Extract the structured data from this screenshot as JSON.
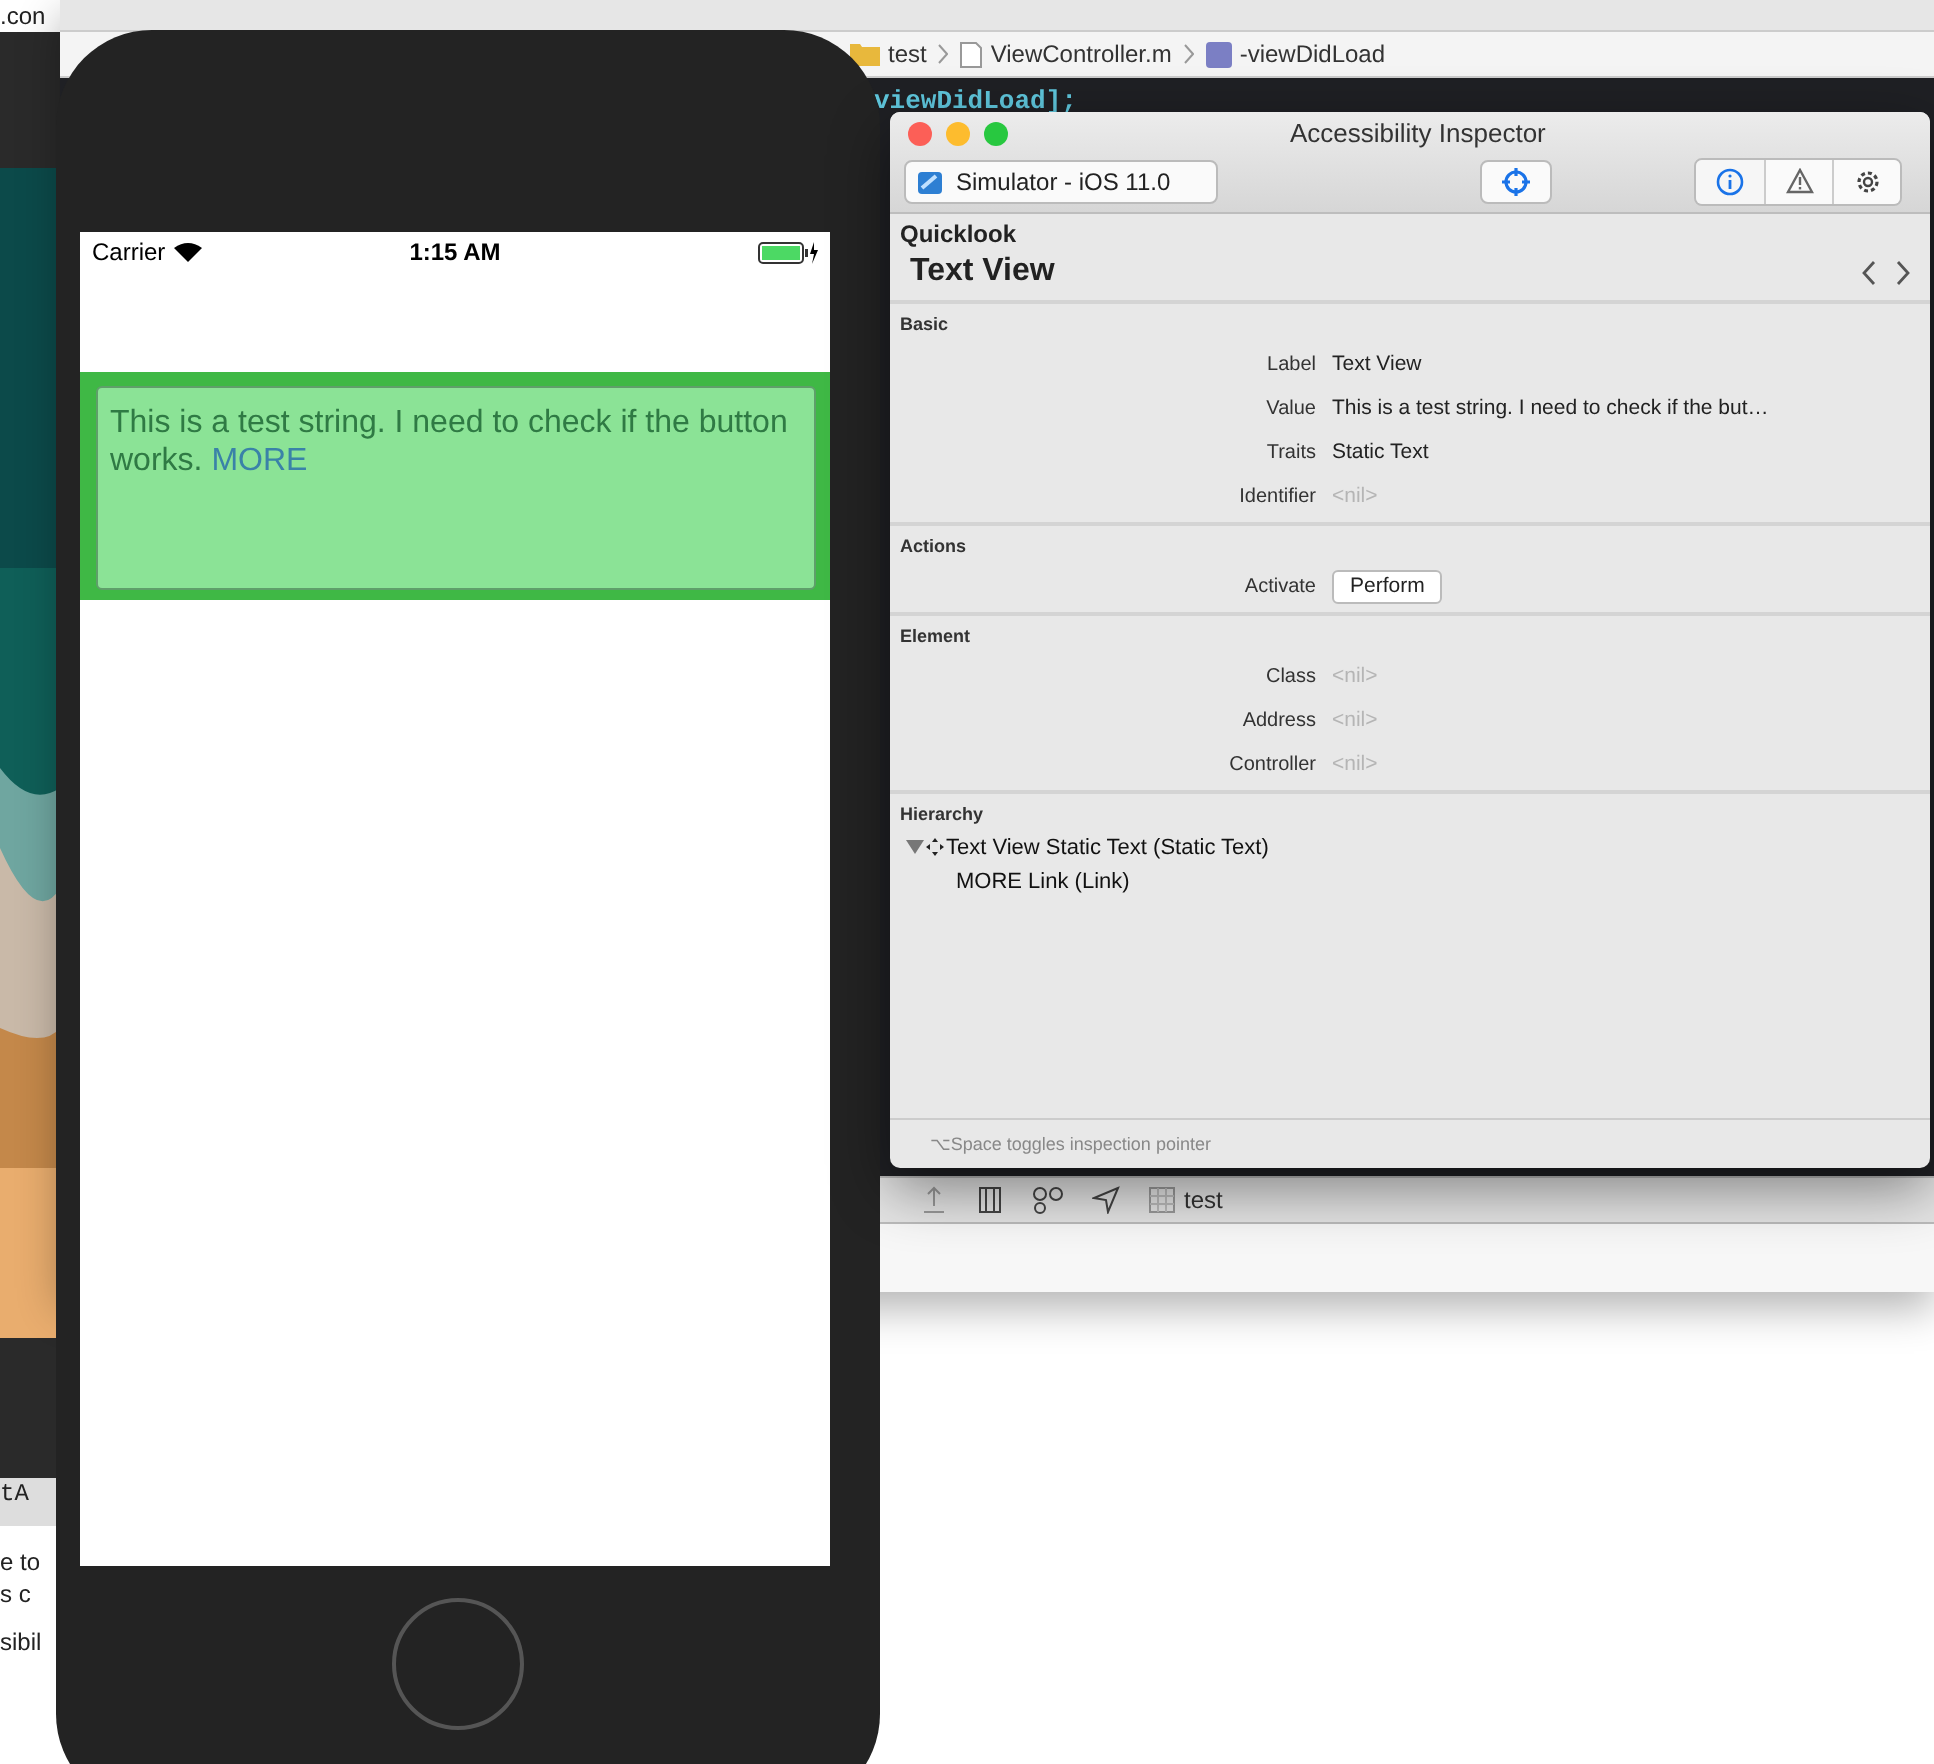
{
  "background_page": {
    "fragments": [
      ".con",
      "tA",
      "e to",
      "s c",
      "sibil"
    ]
  },
  "xcode": {
    "breadcrumbs": [
      "test",
      "ViewController.m",
      "-viewDidLoad"
    ],
    "code_line": "viewDidLoad];",
    "bottom_bar": {
      "scheme": "test"
    }
  },
  "simulator": {
    "status_bar": {
      "carrier": "Carrier",
      "time": "1:15 AM",
      "battery": {
        "level": 1
      }
    },
    "text_view": {
      "text": "This is a test string. I need to check if the button works.",
      "link": "MORE",
      "highlighted": true
    }
  },
  "inspector": {
    "title": "Accessibility Inspector",
    "target": "Simulator - iOS 11.0",
    "tabs": [
      {
        "kind": "info",
        "selected": true
      },
      {
        "kind": "warning",
        "selected": false
      },
      {
        "kind": "settings",
        "selected": false
      }
    ],
    "quicklook": {
      "heading": "Quicklook",
      "title": "Text View"
    },
    "sections": [
      {
        "title": "Basic",
        "rows": [
          {
            "label": "Label",
            "value": "Text View",
            "kind": "text"
          },
          {
            "label": "Value",
            "value": "This is a test string. I need to check if the but…",
            "kind": "text"
          },
          {
            "label": "Traits",
            "value": "Static Text",
            "kind": "text"
          },
          {
            "label": "Identifier",
            "value": "<nil>",
            "kind": "nil"
          }
        ]
      },
      {
        "title": "Actions",
        "rows": [
          {
            "label": "Activate",
            "value": "Perform",
            "kind": "button"
          }
        ]
      },
      {
        "title": "Element",
        "rows": [
          {
            "label": "Class",
            "value": "<nil>",
            "kind": "nil"
          },
          {
            "label": "Address",
            "value": "<nil>",
            "kind": "nil"
          },
          {
            "label": "Controller",
            "value": "<nil>",
            "kind": "nil"
          }
        ]
      }
    ],
    "hierarchy": {
      "title": "Hierarchy",
      "items": [
        {
          "label": "Text View Static Text (Static Text)",
          "expanded": true,
          "children": [
            {
              "label": "MORE Link (Link)"
            }
          ]
        }
      ]
    },
    "footer": "⌥Space toggles inspection pointer"
  }
}
